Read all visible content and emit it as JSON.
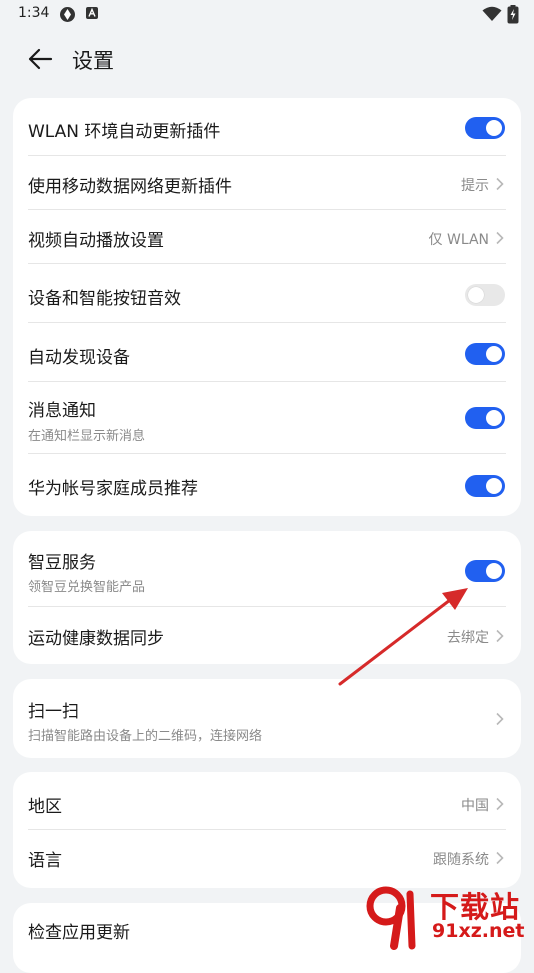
{
  "status_bar": {
    "time": "1:34"
  },
  "header": {
    "title": "设置"
  },
  "cards": {
    "general": [
      {
        "label": "WLAN 环境自动更新插件",
        "control": "toggle",
        "on": true
      },
      {
        "label": "使用移动数据网络更新插件",
        "control": "link",
        "value": "提示"
      },
      {
        "label": "视频自动播放设置",
        "control": "link",
        "value": "仅 WLAN"
      },
      {
        "label": "设备和智能按钮音效",
        "control": "toggle",
        "on": false
      },
      {
        "label": "自动发现设备",
        "control": "toggle",
        "on": true
      },
      {
        "label": "消息通知",
        "sublabel": "在通知栏显示新消息",
        "control": "toggle",
        "on": true
      },
      {
        "label": "华为帐号家庭成员推荐",
        "control": "toggle",
        "on": true
      }
    ],
    "services": [
      {
        "label": "智豆服务",
        "sublabel": "领智豆兑换智能产品",
        "control": "toggle",
        "on": true
      },
      {
        "label": "运动健康数据同步",
        "control": "link",
        "value": "去绑定"
      }
    ],
    "scan": [
      {
        "label": "扫一扫",
        "sublabel": "扫描智能路由设备上的二维码，连接网络",
        "control": "link"
      }
    ],
    "locale": [
      {
        "label": "地区",
        "control": "link",
        "value": "中国"
      },
      {
        "label": "语言",
        "control": "link",
        "value": "跟随系统"
      }
    ],
    "update": [
      {
        "label": "检查应用更新"
      }
    ]
  },
  "watermark": {
    "line1": "下载站",
    "line2": "91xz.net"
  },
  "colors": {
    "accent": "#2160f0",
    "annotation_arrow": "#d62a2a",
    "watermark": "#d51a1a"
  }
}
